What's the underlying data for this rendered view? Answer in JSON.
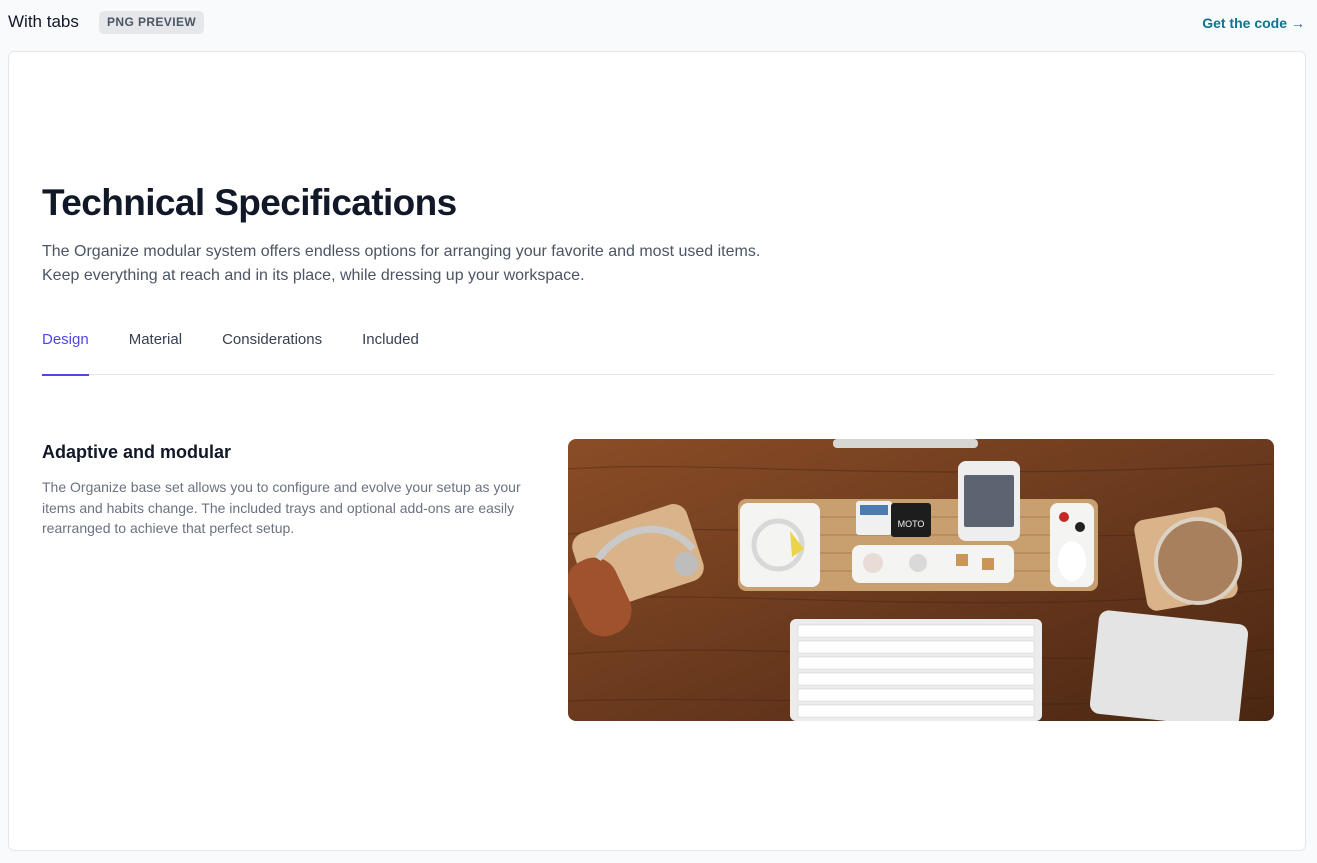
{
  "topbar": {
    "title": "With tabs",
    "badge": "PNG PREVIEW",
    "get_code": "Get the code",
    "get_code_arrow": "→"
  },
  "main": {
    "heading": "Technical Specifications",
    "intro_line1": "The Organize modular system offers endless options for arranging your favorite and most used items.",
    "intro_line2": "Keep everything at reach and in its place, while dressing up your workspace.",
    "tabs": [
      {
        "label": "Design",
        "active": true
      },
      {
        "label": "Material",
        "active": false
      },
      {
        "label": "Considerations",
        "active": false
      },
      {
        "label": "Included",
        "active": false
      }
    ],
    "section": {
      "title": "Adaptive and modular",
      "text": "The Organize base set allows you to configure and evolve your setup as your items and habits change. The included trays and optional add-ons are easily rearranged to achieve that perfect setup."
    },
    "image": {
      "alt": "Walnut desk organizer set with modular white trays, headphones, phone, keyboard, trackpad and coffee",
      "tray_label": "MOTO"
    }
  },
  "colors": {
    "accent": "#4f46e5",
    "link": "#0e7490",
    "heading": "#111827",
    "body_text": "#4b5563",
    "wood": "#6b3a1e"
  }
}
